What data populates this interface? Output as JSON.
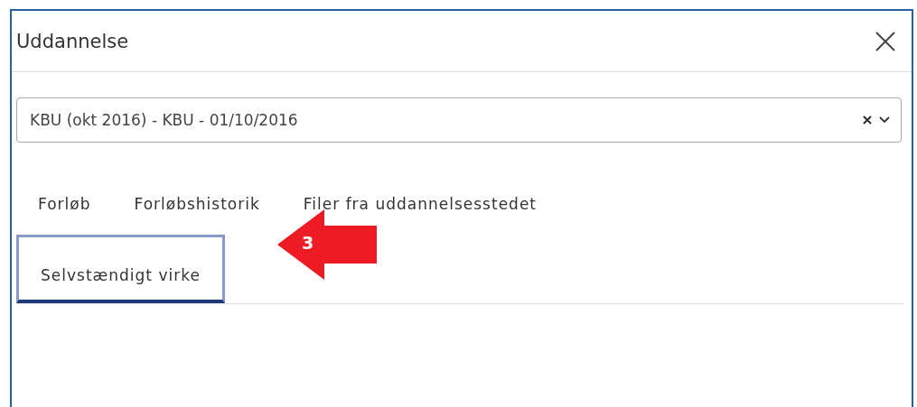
{
  "dialog": {
    "title": "Uddannelse"
  },
  "select": {
    "value": "KBU (okt 2016) - KBU - 01/10/2016"
  },
  "tabs": [
    {
      "label": "Forløb",
      "selected": false
    },
    {
      "label": "Forløbshistorik",
      "selected": false
    },
    {
      "label": "Filer fra uddannelsesstedet",
      "selected": false
    },
    {
      "label": "Selvstændigt virke",
      "selected": true
    }
  ],
  "callout": {
    "label": "3"
  }
}
